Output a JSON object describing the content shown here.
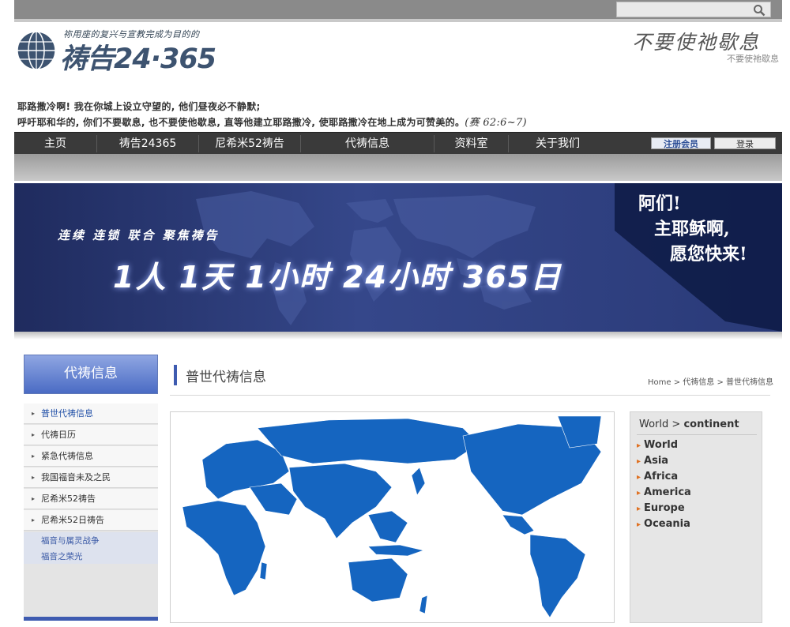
{
  "header": {
    "logo_tagline": "祢用座的复兴与宣教完成为目的的",
    "logo_text": "祷告24·365",
    "slogan_right": "不要使祂歇息",
    "slogan_sub": "不要使祂歇息"
  },
  "verse": {
    "line1": "耶路撒冷啊! 我在你城上设立守望的, 他们昼夜必不静默;",
    "line2": "呼吁耶和华的, 你们不要歇息, 也不要使他歇息, 直等他建立耶路撒冷, 使耶路撒冷在地上成为可赞美的。",
    "ref": "(赛 62:6~7)"
  },
  "nav": {
    "items": [
      "主页",
      "祷告24365",
      "尼希米52祷告",
      "代祷信息",
      "资料室",
      "关于我们"
    ],
    "register": "注册会员",
    "login": "登录"
  },
  "banner": {
    "slogan_small": "连续 连锁 联合 聚焦祷告",
    "slogan_big": "1人 1天 1小时 24小时 365日",
    "amen_1": "阿们!",
    "amen_2": "主耶稣啊,",
    "amen_3": "愿您快来!"
  },
  "sidebar": {
    "title": "代祷信息",
    "items": [
      "普世代祷信息",
      "代祷日历",
      "紧急代祷信息",
      "我国福音未及之民",
      "尼希米52祷告",
      "尼希米52日祷告"
    ],
    "sub_items": [
      "福音与属灵战争",
      "福音之荣光"
    ]
  },
  "main": {
    "title": "普世代祷信息",
    "breadcrumb": "Home > 代祷信息 > 普世代祷信息"
  },
  "continents": {
    "head_world": "World",
    "head_sep": ">",
    "head_current": "continent",
    "items": [
      "World",
      "Asia",
      "Africa",
      "America",
      "Europe",
      "Oceania"
    ]
  },
  "colors": {
    "map_blue": "#1565c0",
    "nav_bg": "#3a3a3a",
    "accent": "#3e5bb0"
  }
}
